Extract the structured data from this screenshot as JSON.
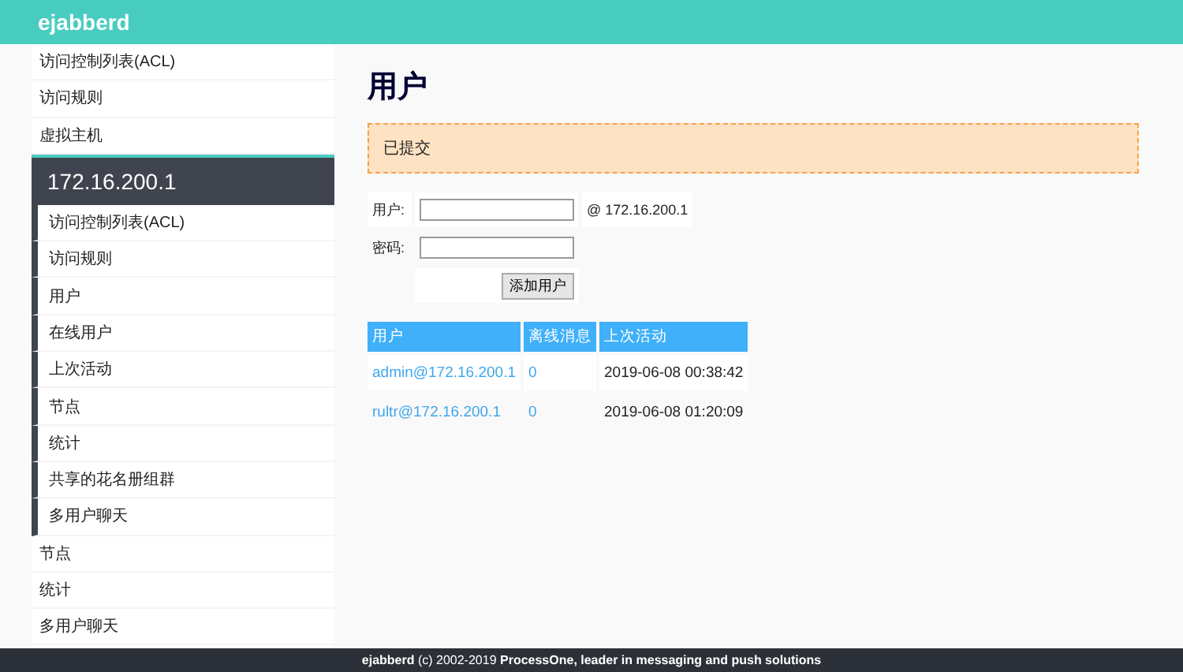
{
  "header": {
    "logo": "ejabberd"
  },
  "sidebar": {
    "items": [
      "访问控制列表(ACL)",
      "访问规则",
      "虚拟主机"
    ],
    "host": {
      "title": "172.16.200.1",
      "items": [
        "访问控制列表(ACL)",
        "访问规则",
        "用户",
        "在线用户",
        "上次活动",
        "节点",
        "统计",
        "共享的花名册组群",
        "多用户聊天"
      ]
    },
    "bottom_items": [
      "节点",
      "统计",
      "多用户聊天"
    ]
  },
  "page": {
    "title": "用户",
    "notice": "已提交",
    "form": {
      "user_label": "用户:",
      "domain": "@ 172.16.200.1",
      "password_label": "密码:",
      "submit": "添加用户"
    },
    "table": {
      "columns": [
        "用户",
        "离线消息",
        "上次活动"
      ],
      "rows": [
        {
          "user": "admin@172.16.200.1",
          "offline": "0",
          "last": "2019-06-08 00:38:42"
        },
        {
          "user": "rultr@172.16.200.1",
          "offline": "0",
          "last": "2019-06-08 01:20:09"
        }
      ]
    }
  },
  "footer": "**ejabberd** (c) 2002-2019 **ProcessOne, leader in messaging and push solutions**"
}
